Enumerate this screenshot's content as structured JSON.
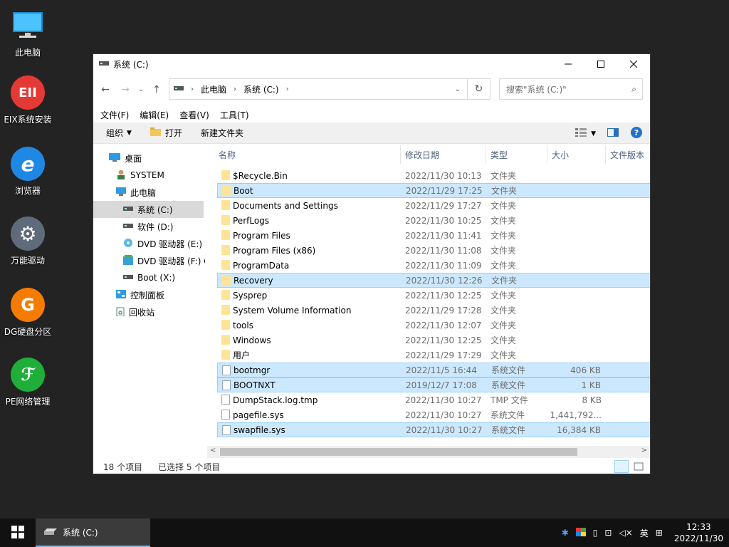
{
  "desktop": {
    "icons": [
      {
        "label": "此电脑"
      },
      {
        "label": "EIX系统安装"
      },
      {
        "label": "浏览器"
      },
      {
        "label": "万能驱动"
      },
      {
        "label": "DG硬盘分区"
      },
      {
        "label": "PE网络管理"
      }
    ]
  },
  "window": {
    "title": "系统 (C:)",
    "breadcrumb": [
      "此电脑",
      "系统 (C:)"
    ],
    "search_placeholder": "搜索\"系统 (C:)\"",
    "menus": [
      "文件(F)",
      "编辑(E)",
      "查看(V)",
      "工具(T)"
    ],
    "toolbar": {
      "organize": "组织",
      "open": "打开",
      "new_folder": "新建文件夹"
    },
    "nav": [
      {
        "label": "桌面"
      },
      {
        "label": "SYSTEM"
      },
      {
        "label": "此电脑"
      },
      {
        "label": "系统 (C:)"
      },
      {
        "label": "软件 (D:)"
      },
      {
        "label": "DVD 驱动器 (E:) E"
      },
      {
        "label": "DVD 驱动器 (F:) C"
      },
      {
        "label": "Boot (X:)"
      },
      {
        "label": "控制面板"
      },
      {
        "label": "回收站"
      }
    ],
    "columns": [
      "名称",
      "修改日期",
      "类型",
      "大小",
      "文件版本"
    ],
    "files": [
      {
        "name": "$Recycle.Bin",
        "date": "2022/11/30 10:13",
        "type": "文件夹",
        "size": "",
        "kind": "folder",
        "selected": false
      },
      {
        "name": "Boot",
        "date": "2022/11/29 17:25",
        "type": "文件夹",
        "size": "",
        "kind": "folder",
        "selected": true
      },
      {
        "name": "Documents and Settings",
        "date": "2022/11/29 17:27",
        "type": "文件夹",
        "size": "",
        "kind": "folder",
        "selected": false
      },
      {
        "name": "PerfLogs",
        "date": "2022/11/30 10:25",
        "type": "文件夹",
        "size": "",
        "kind": "folder",
        "selected": false
      },
      {
        "name": "Program Files",
        "date": "2022/11/30 11:41",
        "type": "文件夹",
        "size": "",
        "kind": "folder",
        "selected": false
      },
      {
        "name": "Program Files (x86)",
        "date": "2022/11/30 11:08",
        "type": "文件夹",
        "size": "",
        "kind": "folder",
        "selected": false
      },
      {
        "name": "ProgramData",
        "date": "2022/11/30 11:09",
        "type": "文件夹",
        "size": "",
        "kind": "folder",
        "selected": false
      },
      {
        "name": "Recovery",
        "date": "2022/11/30 12:26",
        "type": "文件夹",
        "size": "",
        "kind": "folder",
        "selected": true
      },
      {
        "name": "Sysprep",
        "date": "2022/11/30 12:25",
        "type": "文件夹",
        "size": "",
        "kind": "folder",
        "selected": false
      },
      {
        "name": "System Volume Information",
        "date": "2022/11/29 17:28",
        "type": "文件夹",
        "size": "",
        "kind": "folder",
        "selected": false
      },
      {
        "name": "tools",
        "date": "2022/11/30 12:07",
        "type": "文件夹",
        "size": "",
        "kind": "folder",
        "selected": false
      },
      {
        "name": "Windows",
        "date": "2022/11/30 12:25",
        "type": "文件夹",
        "size": "",
        "kind": "folder",
        "selected": false
      },
      {
        "name": "用户",
        "date": "2022/11/29 17:29",
        "type": "文件夹",
        "size": "",
        "kind": "folder",
        "selected": false
      },
      {
        "name": "bootmgr",
        "date": "2022/11/5 16:44",
        "type": "系统文件",
        "size": "406 KB",
        "kind": "file",
        "selected": true
      },
      {
        "name": "BOOTNXT",
        "date": "2019/12/7 17:08",
        "type": "系统文件",
        "size": "1 KB",
        "kind": "file",
        "selected": true
      },
      {
        "name": "DumpStack.log.tmp",
        "date": "2022/11/30 10:27",
        "type": "TMP 文件",
        "size": "8 KB",
        "kind": "file",
        "selected": false
      },
      {
        "name": "pagefile.sys",
        "date": "2022/11/30 10:27",
        "type": "系统文件",
        "size": "1,441,792...",
        "kind": "file",
        "selected": false
      },
      {
        "name": "swapfile.sys",
        "date": "2022/11/30 10:27",
        "type": "系统文件",
        "size": "16,384 KB",
        "kind": "file",
        "selected": true
      }
    ],
    "status": {
      "count": "18 个项目",
      "selected": "已选择 5 个项目"
    }
  },
  "taskbar": {
    "item": "系统 (C:)",
    "ime": "英",
    "time": "12:33",
    "date": "2022/11/30"
  }
}
